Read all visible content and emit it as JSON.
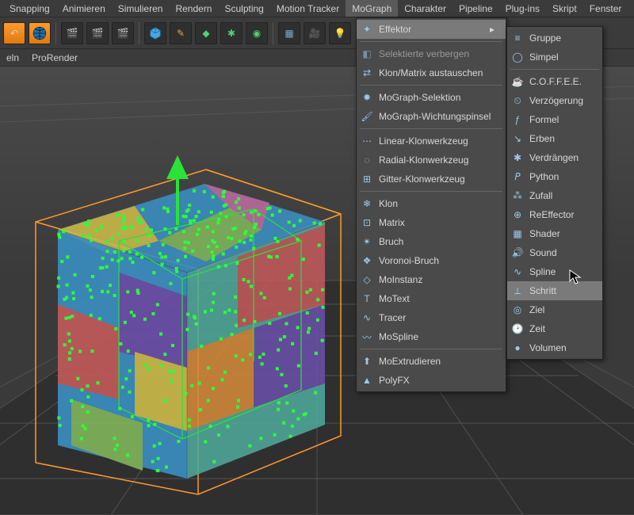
{
  "menubar": {
    "items": [
      "Snapping",
      "Animieren",
      "Simulieren",
      "Rendern",
      "Sculpting",
      "Motion Tracker",
      "MoGraph",
      "Charakter",
      "Pipeline",
      "Plug-ins",
      "Skript",
      "Fenster"
    ],
    "active_index": 6
  },
  "subtoolbar": {
    "items": [
      "eln",
      "ProRender"
    ]
  },
  "dropdown": {
    "groups": [
      {
        "items": [
          {
            "label": "Effektor",
            "icon": "effector-icon",
            "submenu": true,
            "hl": true
          }
        ]
      },
      {
        "items": [
          {
            "label": "Selektierte verbergen",
            "icon": "hide-icon",
            "dim": true
          },
          {
            "label": "Klon/Matrix austauschen",
            "icon": "swap-icon"
          }
        ]
      },
      {
        "items": [
          {
            "label": "MoGraph-Selektion",
            "icon": "selection-icon"
          },
          {
            "label": "MoGraph-Wichtungspinsel",
            "icon": "brush-icon"
          }
        ]
      },
      {
        "items": [
          {
            "label": "Linear-Klonwerkzeug",
            "icon": "linear-icon"
          },
          {
            "label": "Radial-Klonwerkzeug",
            "icon": "radial-icon"
          },
          {
            "label": "Gitter-Klonwerkzeug",
            "icon": "grid-icon"
          }
        ]
      },
      {
        "items": [
          {
            "label": "Klon",
            "icon": "clone-icon"
          },
          {
            "label": "Matrix",
            "icon": "matrix-icon"
          },
          {
            "label": "Bruch",
            "icon": "fracture-icon"
          },
          {
            "label": "Voronoi-Bruch",
            "icon": "voronoi-icon"
          },
          {
            "label": "MoInstanz",
            "icon": "instance-icon"
          },
          {
            "label": "MoText",
            "icon": "text-icon"
          },
          {
            "label": "Tracer",
            "icon": "tracer-icon"
          },
          {
            "label": "MoSpline",
            "icon": "mospline-icon"
          }
        ]
      },
      {
        "items": [
          {
            "label": "MoExtrudieren",
            "icon": "extrude-icon"
          },
          {
            "label": "PolyFX",
            "icon": "polyfx-icon"
          }
        ]
      }
    ]
  },
  "submenu": {
    "groups": [
      {
        "items": [
          {
            "label": "Gruppe",
            "icon": "group-icon"
          },
          {
            "label": "Simpel",
            "icon": "simple-icon"
          }
        ]
      },
      {
        "items": [
          {
            "label": "C.O.F.F.E.E.",
            "icon": "coffee-icon"
          },
          {
            "label": "Verzögerung",
            "icon": "delay-icon"
          },
          {
            "label": "Formel",
            "icon": "formula-icon"
          },
          {
            "label": "Erben",
            "icon": "inherit-icon"
          },
          {
            "label": "Verdrängen",
            "icon": "push-icon"
          },
          {
            "label": "Python",
            "icon": "python-icon"
          },
          {
            "label": "Zufall",
            "icon": "random-icon"
          },
          {
            "label": "ReEffector",
            "icon": "reeffector-icon"
          },
          {
            "label": "Shader",
            "icon": "shader-icon"
          },
          {
            "label": "Sound",
            "icon": "sound-icon"
          },
          {
            "label": "Spline",
            "icon": "spline-icon"
          },
          {
            "label": "Schritt",
            "icon": "step-icon",
            "hl": true
          },
          {
            "label": "Ziel",
            "icon": "target-icon"
          },
          {
            "label": "Zeit",
            "icon": "time-icon"
          },
          {
            "label": "Volumen",
            "icon": "volume-icon"
          }
        ]
      }
    ]
  },
  "viewport": {
    "object": "voronoi-cube",
    "palette": [
      "#3a8dbf",
      "#c15a5a",
      "#c9b84a",
      "#7fb35a",
      "#6a4fa8",
      "#b86b9e",
      "#4fa89b",
      "#d28a3a"
    ]
  }
}
